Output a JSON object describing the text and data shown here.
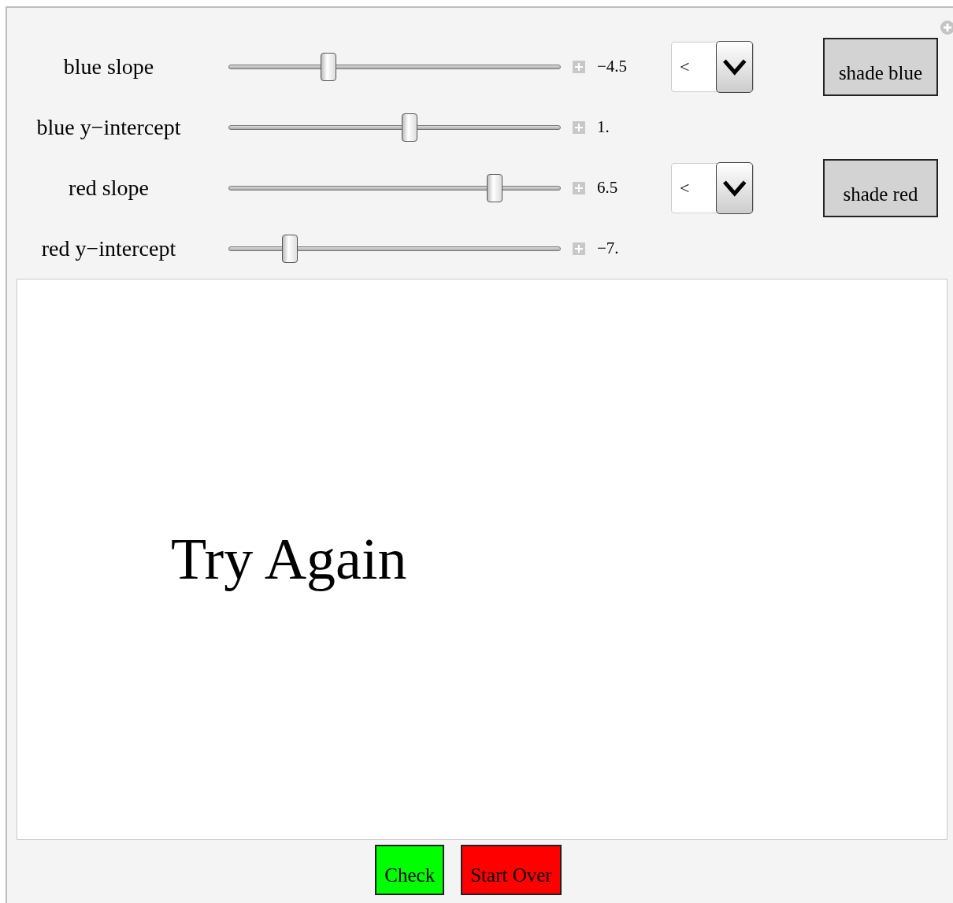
{
  "controls": [
    {
      "label": "blue slope",
      "level": 0.3,
      "value": "−4.5",
      "dropdown": {
        "value": "<"
      },
      "button": {
        "label": "shade blue"
      }
    },
    {
      "label": "blue y−intercept",
      "level": 0.545,
      "value": "1."
    },
    {
      "label": "red slope",
      "level": 0.8,
      "value": "6.5",
      "dropdown": {
        "value": "<"
      },
      "button": {
        "label": "shade red"
      }
    },
    {
      "label": "red y−intercept",
      "level": 0.185,
      "value": "−7."
    }
  ],
  "plot": {
    "message": "Try Again"
  },
  "buttons": [
    {
      "label": "Check",
      "color": "#00ff00"
    },
    {
      "label": "Start Over",
      "color": "#ff0000"
    }
  ]
}
